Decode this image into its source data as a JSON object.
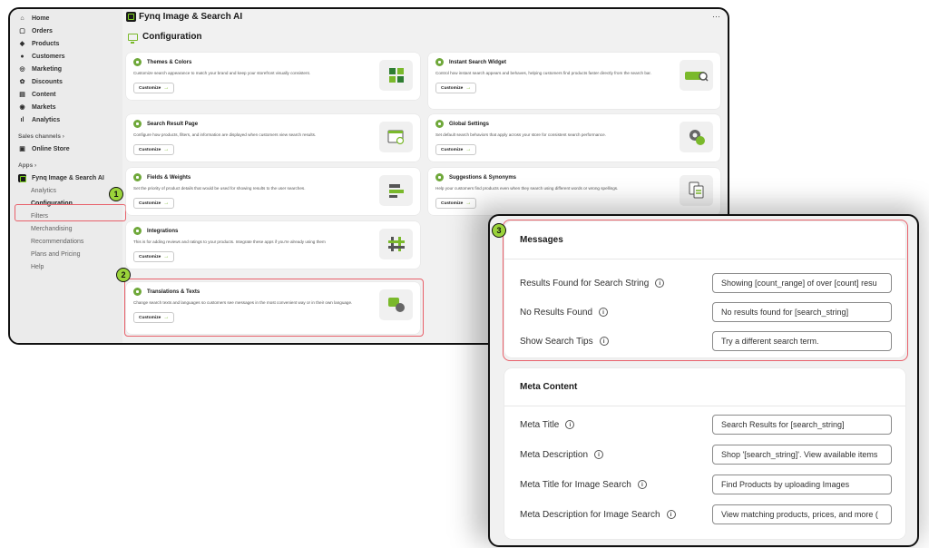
{
  "sidebar": {
    "nav": [
      {
        "label": "Home",
        "icon": "home-icon",
        "glyph": "⌂"
      },
      {
        "label": "Orders",
        "icon": "orders-icon",
        "glyph": "▢"
      },
      {
        "label": "Products",
        "icon": "products-icon",
        "glyph": "◆"
      },
      {
        "label": "Customers",
        "icon": "customers-icon",
        "glyph": "●"
      },
      {
        "label": "Marketing",
        "icon": "marketing-icon",
        "glyph": "◎"
      },
      {
        "label": "Discounts",
        "icon": "discounts-icon",
        "glyph": "✿"
      },
      {
        "label": "Content",
        "icon": "content-icon",
        "glyph": "▤"
      },
      {
        "label": "Markets",
        "icon": "markets-icon",
        "glyph": "◉"
      },
      {
        "label": "Analytics",
        "icon": "analytics-icon",
        "glyph": "ıl"
      }
    ],
    "sales_channels_label": "Sales channels",
    "online_store_label": "Online Store",
    "apps_label": "Apps",
    "app_name": "Fynq Image & Search AI",
    "app_items": [
      "Analytics",
      "Configuration",
      "Filters",
      "Merchandising",
      "Recommendations",
      "Plans and Pricing",
      "Help"
    ],
    "active_item": "Configuration"
  },
  "header": {
    "app_title": "Fynq Image & Search AI",
    "more_label": "···",
    "page_title": "Configuration"
  },
  "cards": [
    {
      "title": "Themes & Colors",
      "desc": "Customize search appearance to match your brand and keep your storefront visually consistent.",
      "button": "Customize",
      "thumb": "themes-thumbnail-icon"
    },
    {
      "title": "Instant Search Widget",
      "desc": "Control how instant search appears and behaves, helping customers find products faster directly from the search bar.",
      "button": "Customize",
      "thumb": "instant-search-thumbnail-icon"
    },
    {
      "title": "Search Result Page",
      "desc": "Configure how products, filters, and information are displayed when customers view search results.",
      "button": "Customize",
      "thumb": "search-result-thumbnail-icon"
    },
    {
      "title": "Global Settings",
      "desc": "Set default search behaviors that apply across your store for consistent search performance.",
      "button": "Customize",
      "thumb": "global-settings-thumbnail-icon"
    },
    {
      "title": "Fields & Weights",
      "desc": "Set the priority of product details that would be used for showing results to the user searches.",
      "button": "Customize",
      "thumb": "fields-weights-thumbnail-icon"
    },
    {
      "title": "Suggestions & Synonyms",
      "desc": "Help your customers find products even when they search using different words or wrong spellings.",
      "button": "Customize",
      "thumb": "suggestions-thumbnail-icon"
    },
    {
      "title": "Integrations",
      "desc": "This is for adding reviews and ratings to your products. Integrate these apps if you're already using them",
      "button": "Customize",
      "thumb": "integrations-thumbnail-icon"
    },
    {
      "title": "Translations & Texts",
      "desc": "Change search texts and languages so customers see messages in the most convenient way or in their own language.",
      "button": "Customize",
      "thumb": "translations-thumbnail-icon"
    }
  ],
  "callouts": [
    "1",
    "2",
    "3"
  ],
  "messages": {
    "title": "Messages",
    "rows": [
      {
        "label": "Results Found for Search String",
        "value": "Showing [count_range] of over [count] resu"
      },
      {
        "label": "No Results Found",
        "value": "No results found for [search_string]"
      },
      {
        "label": "Show Search Tips",
        "value": "Try a different search term."
      }
    ]
  },
  "meta": {
    "title": "Meta Content",
    "rows": [
      {
        "label": "Meta Title",
        "value": "Search Results for [search_string]"
      },
      {
        "label": "Meta Description",
        "value": "Shop '[search_string]'. View available items"
      },
      {
        "label": "Meta Title for Image Search",
        "value": "Find Products by uploading Images"
      },
      {
        "label": "Meta Description for Image Search",
        "value": "View matching products, prices, and more ("
      }
    ]
  },
  "colors": {
    "accent": "#7ab92b",
    "highlight": "#e8606a",
    "badge": "#9ad33a"
  }
}
